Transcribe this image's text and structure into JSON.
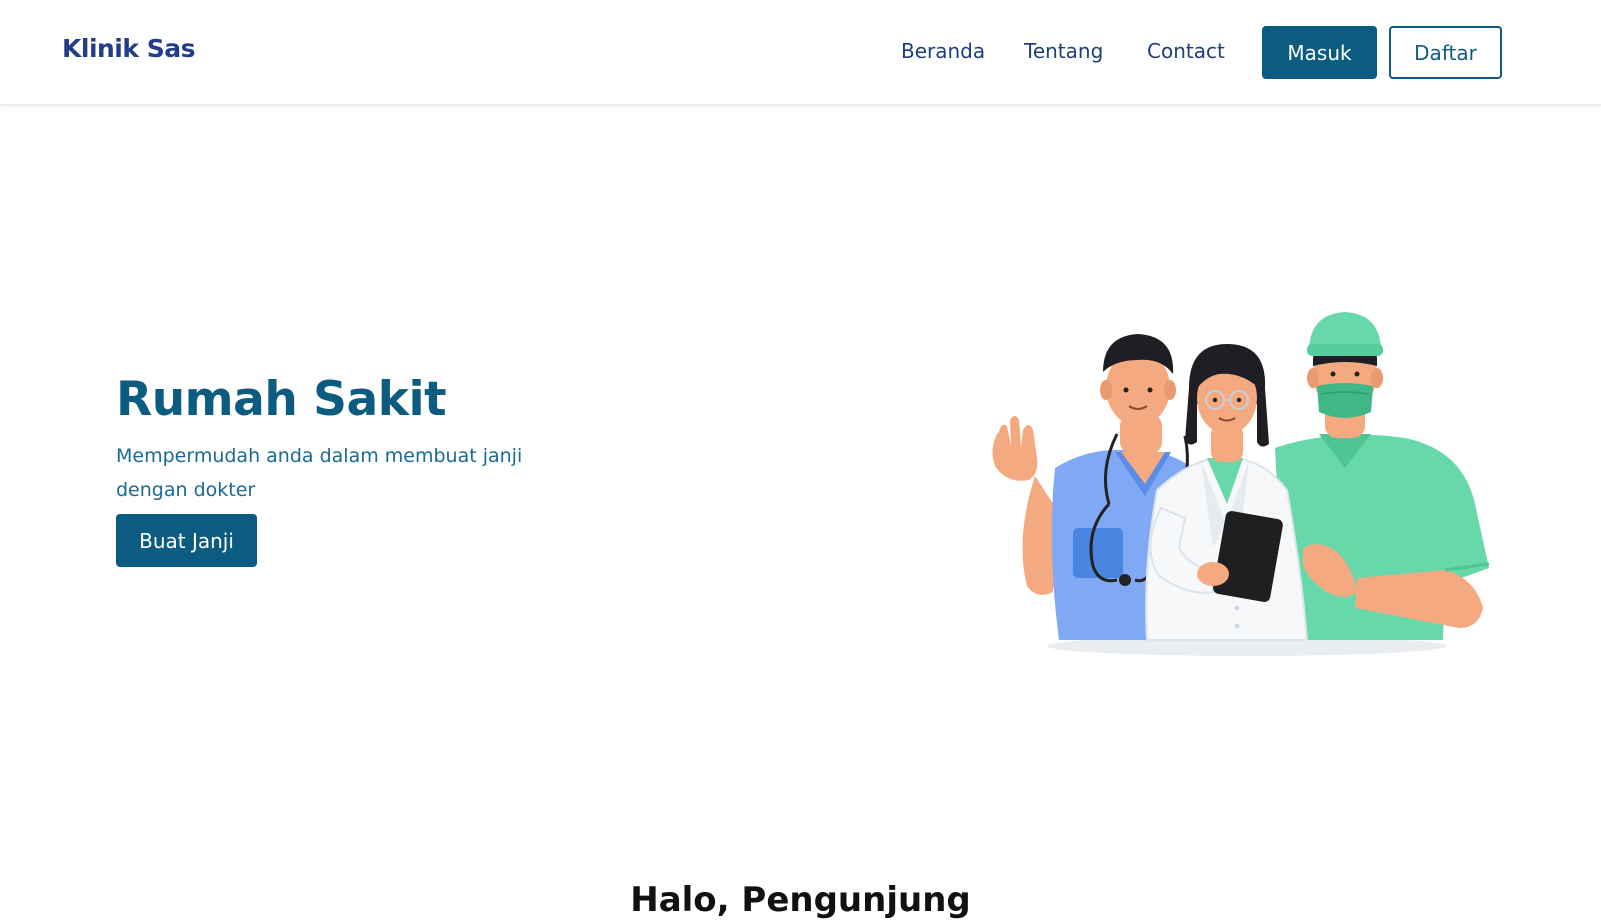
{
  "nav": {
    "brand": "Klinik Sas",
    "links": [
      "Beranda",
      "Tentang",
      "Contact"
    ],
    "login_label": "Masuk",
    "register_label": "Daftar"
  },
  "hero": {
    "title": "Rumah Sakit",
    "subtitle": "Mempermudah anda dalam membuat janji dengan dokter",
    "cta_label": "Buat Janji",
    "illustration": "medical-staff-illustration"
  },
  "section": {
    "heading": "Halo, Pengunjung"
  },
  "colors": {
    "primary": "#0c5b80",
    "brand": "#243d8a",
    "nav_link": "#1f3f7a"
  }
}
